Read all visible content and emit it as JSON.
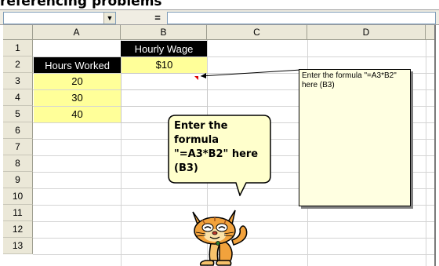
{
  "page": {
    "title": "referencing problems"
  },
  "toolbar": {
    "name_box_value": "",
    "formula_equals_label": "=",
    "formula_value": "",
    "dropdown_icon": "triangle-down"
  },
  "columns": [
    "A",
    "B",
    "C",
    "D"
  ],
  "rows": [
    "1",
    "2",
    "3",
    "4",
    "5",
    "6",
    "7",
    "8",
    "9",
    "10",
    "11",
    "12",
    "13"
  ],
  "cells": {
    "B1": "Hourly Wage",
    "A2": "Hours Worked",
    "B2": "$10",
    "A3": "20",
    "A4": "30",
    "A5": "40"
  },
  "comment": {
    "text": "Enter the formula \"=A3*B2\" here (B3)"
  },
  "callout": {
    "text": "Enter the formula \"=A3*B2\" here (B3)"
  },
  "colors": {
    "header_fill": "#000000",
    "data_fill": "#ffff99",
    "comment_fill": "#ffffe1",
    "callout_fill": "#ffffcc",
    "comment_marker": "#e00000"
  },
  "mascot": {
    "icon": "cartoon-cat-icon"
  }
}
